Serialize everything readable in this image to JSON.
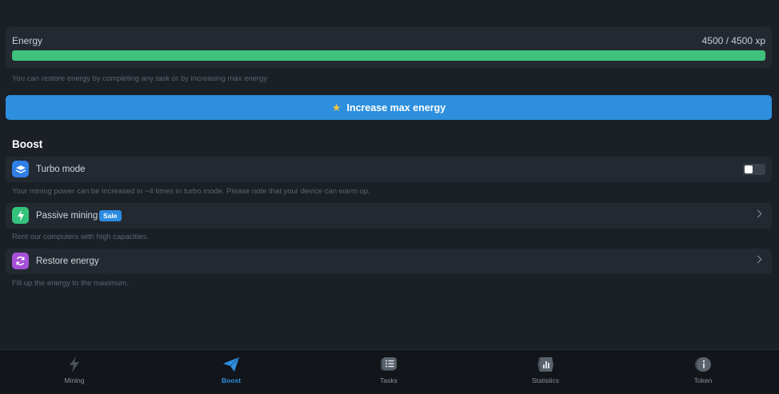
{
  "energy": {
    "label": "Energy",
    "value_text": "4500 / 4500 xp",
    "fill_fraction": 1.0,
    "bar_color": "#3fc07d",
    "hint": "You can restore energy by completing any task or by increasing max energy"
  },
  "increase_button": {
    "icon": "star-icon",
    "label": "Increase max energy",
    "color": "#2d8fdd"
  },
  "boost": {
    "title": "Boost",
    "items": [
      {
        "label": "Turbo mode",
        "icon": "turbo-icon",
        "icon_color": "#2f7fe6",
        "control": "toggle",
        "toggle_on": false,
        "description": "Your mining power can be increased in ~4 times in turbo mode. Please note that your device can warm up."
      },
      {
        "label": "Passive mining",
        "badge": "Sale",
        "icon": "lightning-icon",
        "icon_color": "#34c27a",
        "control": "chevron",
        "description": "Rent our computers with high capacities."
      },
      {
        "label": "Restore energy",
        "icon": "refresh-icon",
        "icon_color": "#a64fd8",
        "control": "chevron",
        "description": "Fill up the energy to the maximum."
      }
    ]
  },
  "nav": {
    "items": [
      {
        "label": "Mining",
        "icon": "lightning-icon",
        "active": false
      },
      {
        "label": "Boost",
        "icon": "paper-plane-icon",
        "active": true
      },
      {
        "label": "Tasks",
        "icon": "list-icon",
        "active": false
      },
      {
        "label": "Statistics",
        "icon": "bar-chart-icon",
        "active": false
      },
      {
        "label": "Token",
        "icon": "info-icon",
        "active": false
      }
    ],
    "active_color": "#2f8fe0"
  }
}
